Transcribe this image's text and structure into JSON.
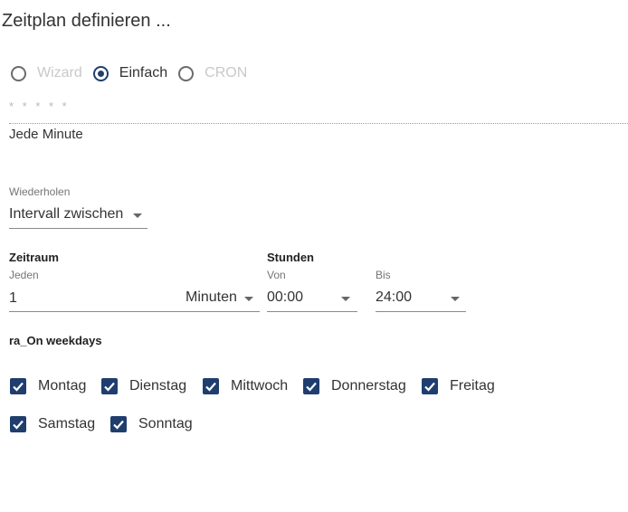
{
  "dialog": {
    "title": "Zeitplan definieren ..."
  },
  "mode": {
    "options": [
      {
        "label": "Wizard",
        "checked": false,
        "disabled": true
      },
      {
        "label": "Einfach",
        "checked": true,
        "disabled": false
      },
      {
        "label": "CRON",
        "checked": false,
        "disabled": true
      }
    ]
  },
  "cron": {
    "expression": "* * * * *",
    "description": "Jede Minute"
  },
  "repeat": {
    "label": "Wiederholen",
    "value": "Intervall zwischen"
  },
  "period": {
    "heading": "Zeitraum",
    "every_label": "Jeden",
    "every_value": "1",
    "unit_value": "Minuten"
  },
  "hours": {
    "heading": "Stunden",
    "from_label": "Von",
    "from_value": "00:00",
    "to_label": "Bis",
    "to_value": "24:00"
  },
  "weekdays": {
    "heading": "ra_On weekdays",
    "days": [
      {
        "label": "Montag",
        "checked": true
      },
      {
        "label": "Dienstag",
        "checked": true
      },
      {
        "label": "Mittwoch",
        "checked": true
      },
      {
        "label": "Donnerstag",
        "checked": true
      },
      {
        "label": "Freitag",
        "checked": true
      },
      {
        "label": "Samstag",
        "checked": true
      },
      {
        "label": "Sonntag",
        "checked": true
      }
    ]
  },
  "colors": {
    "accent": "#1f3e6e",
    "disabled_text": "#c9c9c9"
  }
}
